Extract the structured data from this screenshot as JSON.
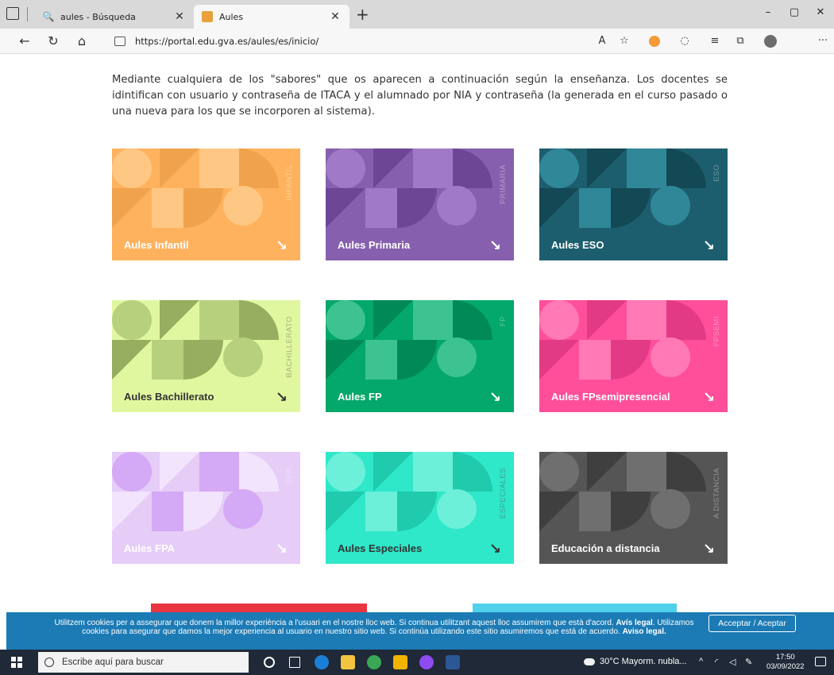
{
  "browser": {
    "tabs": [
      {
        "title": "aules - Búsqueda",
        "icon": "search-icon"
      },
      {
        "title": "Aules",
        "icon": "aules-favicon"
      }
    ],
    "url": "https://portal.edu.gva.es/aules/es/inicio/",
    "window_controls": [
      "–",
      "▢",
      "✕"
    ]
  },
  "page": {
    "intro": "Mediante cualquiera de los \"sabores\" que os aparecen a continuación según la enseñanza. Los docentes se idintifican con usuario y contraseña de ITACA y el alumnado por NIA y contraseña (la generada en el curso pasado o una nueva para los que se incorporen al sistema).",
    "cards": [
      {
        "title": "Aules Infantil",
        "side_label": "INFANTIL",
        "bg": "#ffb25e",
        "shape": "#ffc784",
        "shape2": "#f0a24c",
        "text": "#ffffff"
      },
      {
        "title": "Aules Primaria",
        "side_label": "PRIMARIA",
        "bg": "#8660ae",
        "shape": "#a07ac7",
        "shape2": "#6d4796",
        "text": "#ffffff"
      },
      {
        "title": "Aules ESO",
        "side_label": "ESO",
        "bg": "#1d5e6e",
        "shape": "#2f8798",
        "shape2": "#134855",
        "text": "#ffffff"
      },
      {
        "title": "Aules Bachillerato",
        "side_label": "BACHILLERATO",
        "bg": "#e0f7a0",
        "shape": "#b7d07e",
        "shape2": "#97ad5f",
        "text": "#333333"
      },
      {
        "title": "Aules FP",
        "side_label": "FP",
        "bg": "#03a86a",
        "shape": "#3cc390",
        "shape2": "#028a56",
        "text": "#ffffff"
      },
      {
        "title": "Aules FPsemipresencial",
        "side_label": "FPSEMI",
        "bg": "#ff4f9a",
        "shape": "#ff79b4",
        "shape2": "#e33a85",
        "text": "#ffffff"
      },
      {
        "title": "Aules FPA",
        "side_label": "FPA",
        "bg": "#e6cdf8",
        "shape": "#d4a9f5",
        "shape2": "#f2e4fc",
        "text": "#ffffff"
      },
      {
        "title": "Aules Especiales",
        "side_label": "ESPECIALES",
        "bg": "#2fe7c9",
        "shape": "#6cf0da",
        "shape2": "#1fcaad",
        "text": "#333333"
      },
      {
        "title": "Educación a distancia",
        "side_label": "A DISTANCIA",
        "bg": "#555555",
        "shape": "#6f6f6f",
        "shape2": "#3f3f3f",
        "text": "#ffffff"
      }
    ]
  },
  "cookie": {
    "part1": "Utilitzem cookies per a assegurar que donem la millor experiència a l'usuari en el nostre lloc web. Si continua utilitzant aquest lloc assumirem que està d'acord.",
    "link1": "Avís legal",
    "part2": "Utilizamos cookies para asegurar que damos la mejor experiencia al usuario en nuestro sitio web. Si continúa utilizando este sitio asumiremos que está de acuerdo.",
    "link2": "Aviso legal.",
    "accept": "Acceptar / Aceptar"
  },
  "taskbar": {
    "search_placeholder": "Escribe aquí para buscar",
    "weather": "30°C  Mayorm. nubla...",
    "time": "17:50",
    "date": "03/09/2022"
  }
}
